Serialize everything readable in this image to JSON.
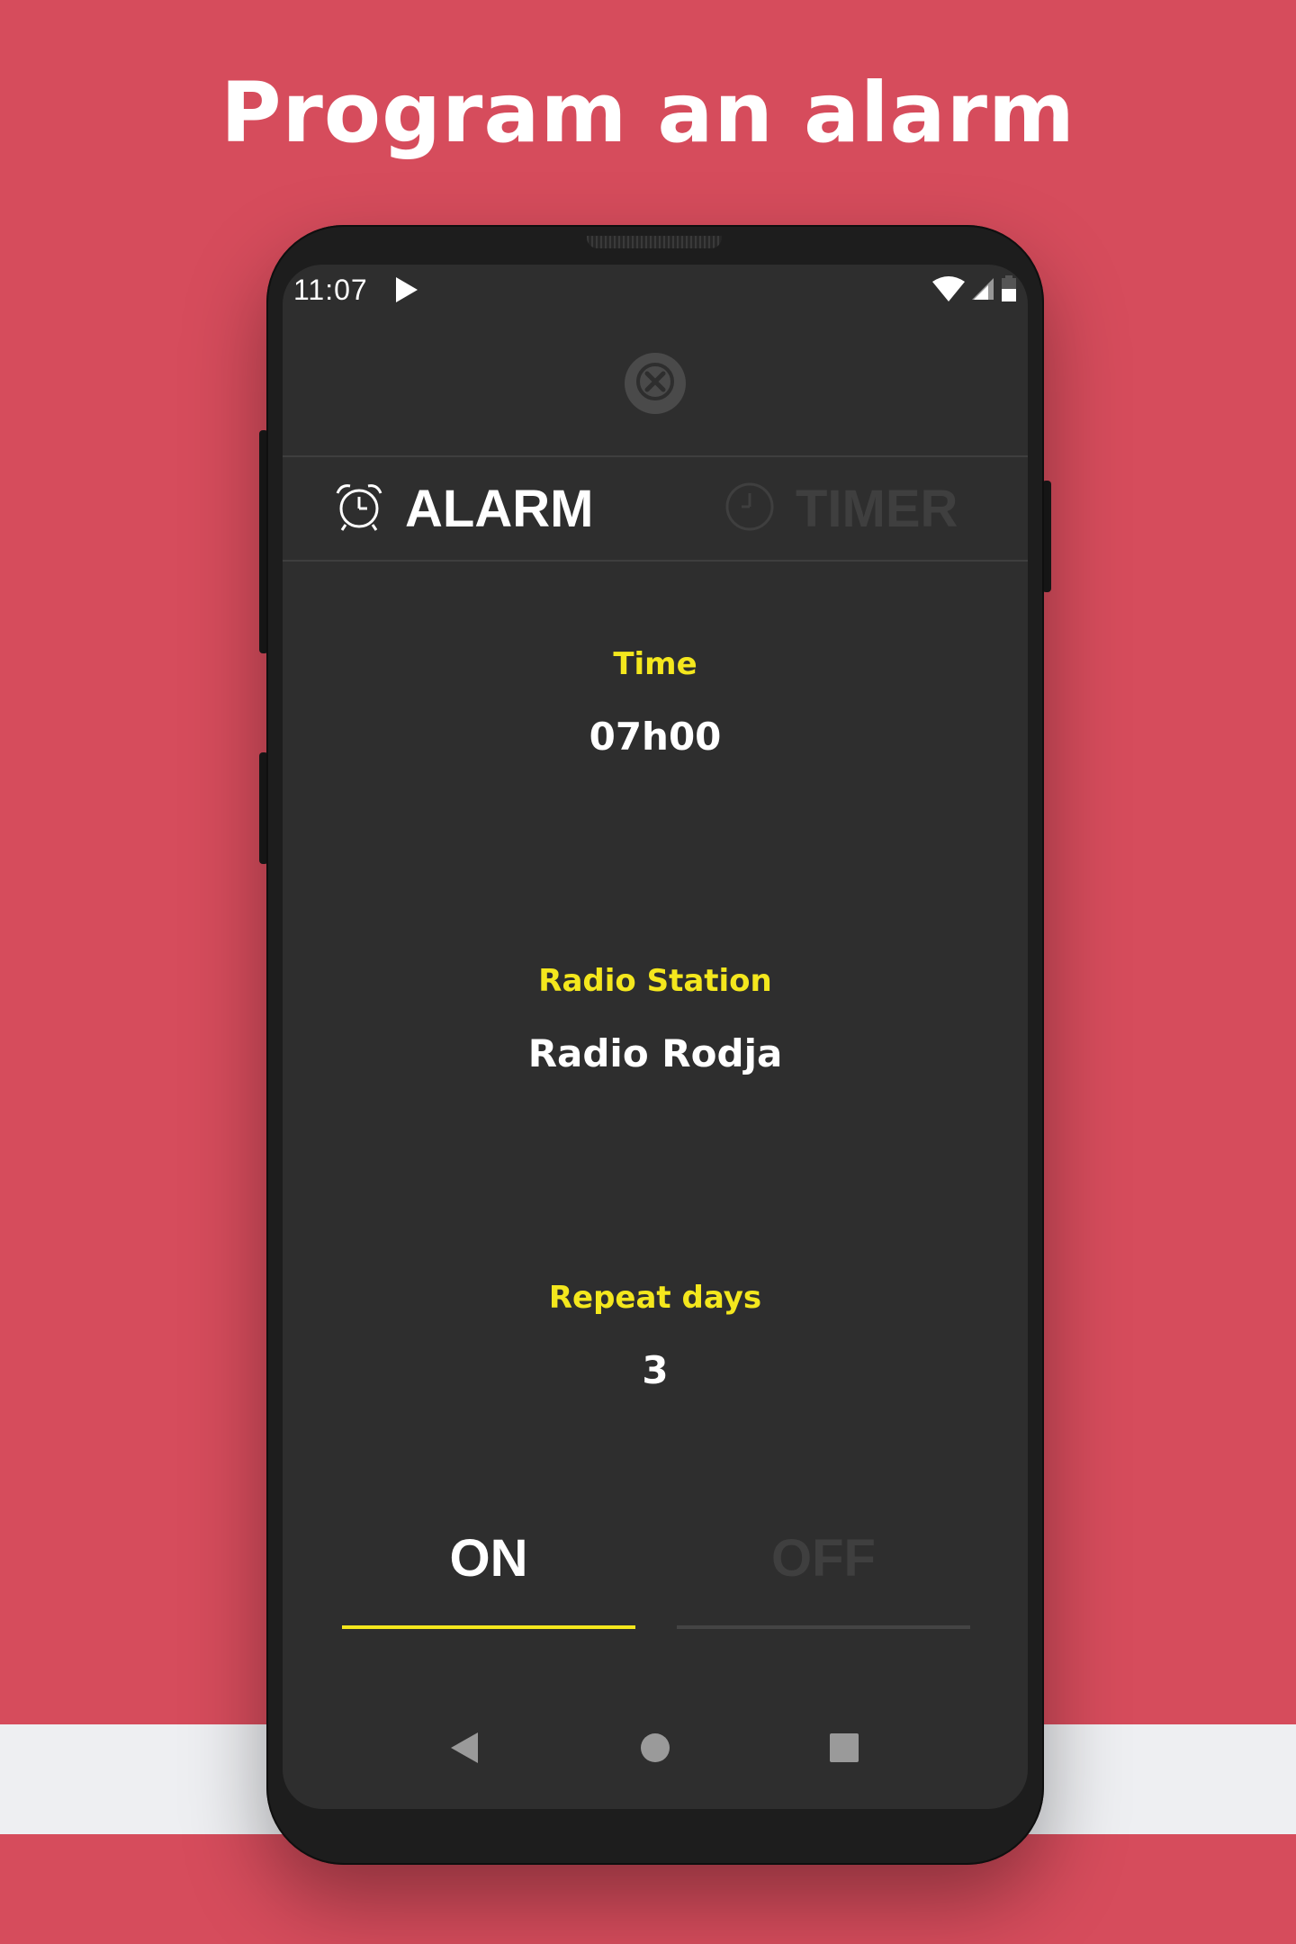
{
  "headline": "Program an alarm",
  "status_bar": {
    "time": "11:07"
  },
  "tabs": [
    {
      "label": "ALARM",
      "icon": "alarm-clock-icon",
      "active": true
    },
    {
      "label": "TIMER",
      "icon": "clock-icon",
      "active": false
    }
  ],
  "fields": {
    "time": {
      "label": "Time",
      "value": "07h00"
    },
    "station": {
      "label": "Radio Station",
      "value": "Radio Rodja"
    },
    "repeat": {
      "label": "Repeat days",
      "value": "3"
    }
  },
  "toggle": {
    "on_label": "ON",
    "off_label": "OFF",
    "selected": "ON"
  },
  "colors": {
    "background": "#d64c5c",
    "accent": "#f4e71d",
    "screen": "#2e2e2e"
  }
}
